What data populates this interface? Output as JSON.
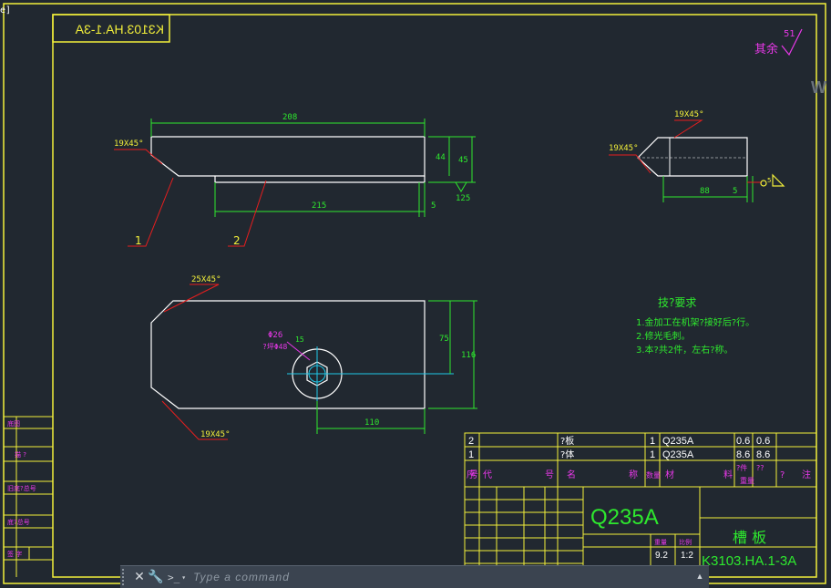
{
  "corner_label": "e]",
  "watermark": "W",
  "title_box_mirrored": "K3103.HA.1-3A",
  "roughness": {
    "value": "51",
    "label": "其余"
  },
  "part1": {
    "chamfer_left": "19X45°",
    "length": "208",
    "height_inner": "44",
    "height_outer": "45",
    "bottom_len": "215",
    "bottom_gap": "5",
    "finish": "125",
    "leader1": "1",
    "leader2": "2"
  },
  "part_side": {
    "chamfer_top": "19X45°",
    "chamfer_left": "19X45°",
    "width": "88",
    "gap": "5",
    "weld": "5"
  },
  "plate": {
    "chamfer_top": "25X45°",
    "chamfer_bottom": "19X45°",
    "hole_dia": "Φ26",
    "hole_note": "?坪Φ48",
    "dim_75": "75",
    "dim_116": "116",
    "dim_110": "110",
    "dim_15": "15"
  },
  "requirements": {
    "title": "技?要求",
    "items": [
      "1.金加工在机架?接好后?行。",
      "2.修光毛刺。",
      "3.本?共2件，左右?称。"
    ]
  },
  "bom": {
    "rows": [
      {
        "no": "2",
        "name": "?板",
        "qty": "1",
        "material": "Q235A",
        "w1": "0.6",
        "w2": "0.6"
      },
      {
        "no": "1",
        "name": "?体",
        "qty": "1",
        "material": "Q235A",
        "w1": "8.6",
        "w2": "8.6"
      }
    ],
    "header": {
      "no": "序号",
      "code": "代",
      "code2": "号",
      "name": "名",
      "name2": "称",
      "qty": "数量",
      "material": "材",
      "material2": "料",
      "unit": "?件",
      "total": "??",
      "weight": "重量",
      "remark": "?",
      "remark2": "注"
    }
  },
  "title_block": {
    "material": "Q235A",
    "part_name": "槽 板",
    "drawing_no": "K3103.HA.1-3A",
    "weight": "9.2",
    "scale": "1:2",
    "weight_label": "重量",
    "scale_label": "比例"
  },
  "left_strip": [
    "底图",
    "描 ?",
    "旧底?总号",
    "底?总号",
    "签 字"
  ],
  "command": {
    "close_label": "✕",
    "tool_label": "🔧",
    "prompt_label": ">_",
    "placeholder": "Type a command"
  }
}
